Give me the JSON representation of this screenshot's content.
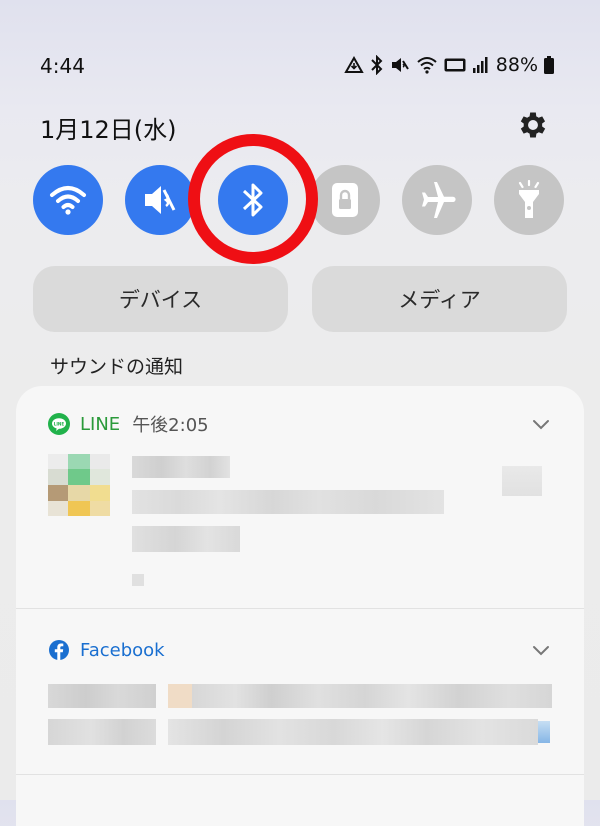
{
  "status": {
    "time": "4:44",
    "battery": "88%",
    "icons": [
      "data-saver-icon",
      "bluetooth-icon",
      "mute-icon",
      "wifi-calling-icon",
      "volte-icon",
      "signal-icon",
      "battery-icon"
    ]
  },
  "header": {
    "date": "1月12日(水)",
    "settings_icon": "gear-icon"
  },
  "quick_tiles": [
    {
      "name": "wifi",
      "icon": "wifi-icon",
      "state": "on"
    },
    {
      "name": "sound",
      "icon": "mute-icon",
      "state": "on"
    },
    {
      "name": "bluetooth",
      "icon": "bluetooth-icon",
      "state": "on"
    },
    {
      "name": "lock",
      "icon": "lock-icon",
      "state": "off"
    },
    {
      "name": "airplane",
      "icon": "airplane-icon",
      "state": "off"
    },
    {
      "name": "flashlight",
      "icon": "flashlight-icon",
      "state": "off"
    }
  ],
  "buttons": {
    "devices": "デバイス",
    "media": "メディア"
  },
  "section": {
    "title": "サウンドの通知"
  },
  "notifications": [
    {
      "app": "LINE",
      "time": "午後2:05",
      "icon": "line-icon",
      "content": "pixelated"
    },
    {
      "app": "Facebook",
      "time": "",
      "icon": "facebook-icon",
      "content": "pixelated"
    }
  ],
  "colors": {
    "accent": "#3479ef",
    "tile_off": "#c5c5c5",
    "highlight": "#ef0f14",
    "line_green": "#2a9a3a",
    "facebook_blue": "#1a6fd0"
  }
}
